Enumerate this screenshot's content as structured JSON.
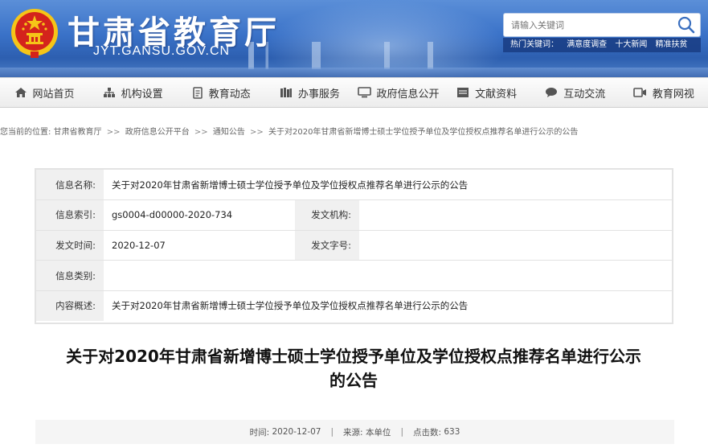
{
  "header": {
    "site_title": "甘肃省教育厅",
    "site_domain": "JYT.GANSU.GOV.CN",
    "search": {
      "placeholder": "请输入关键词"
    },
    "hotwords": {
      "label": "热门关键词：",
      "items": [
        "满意度调查",
        "十大新闻",
        "精准扶贫"
      ]
    }
  },
  "nav": {
    "items": [
      {
        "label": "网站首页",
        "icon": "home-icon"
      },
      {
        "label": "机构设置",
        "icon": "org-chart-icon"
      },
      {
        "label": "教育动态",
        "icon": "document-icon"
      },
      {
        "label": "办事服务",
        "icon": "books-icon"
      },
      {
        "label": "政府信息公开",
        "icon": "monitor-icon"
      },
      {
        "label": "文献资料",
        "icon": "folder-icon"
      },
      {
        "label": "互动交流",
        "icon": "chat-icon"
      },
      {
        "label": "教育网视",
        "icon": "video-icon"
      }
    ]
  },
  "breadcrumb": {
    "prefix": "您当前的位置:",
    "items": [
      "甘肃省教育厅",
      "政府信息公开平台",
      "通知公告",
      "关于对2020年甘肃省新增博士硕士学位授予单位及学位授权点推荐名单进行公示的公告"
    ],
    "separator": ">>"
  },
  "info": {
    "name_label": "信息名称:",
    "name_value": "关于对2020年甘肃省新增博士硕士学位授予单位及学位授权点推荐名单进行公示的公告",
    "index_label": "信息索引:",
    "index_value": "gs0004-d00000-2020-734",
    "org_label": "发文机构:",
    "org_value": "",
    "date_label": "发文时间:",
    "date_value": "2020-12-07",
    "docno_label": "发文字号:",
    "docno_value": "",
    "category_label": "信息类别:",
    "category_value": "",
    "summary_label": "内容概述:",
    "summary_value": "关于对2020年甘肃省新增博士硕士学位授予单位及学位授权点推荐名单进行公示的公告"
  },
  "article": {
    "title_line1": "关于对2020年甘肃省新增博士硕士学位授予单位及学位授权点推荐名单进行公示",
    "title_line2": "的公告"
  },
  "meta": {
    "time_label": "时间:",
    "time_value": "2020-12-07",
    "source_label": "来源:",
    "source_value": "本单位",
    "clicks_label": "点击数:",
    "clicks_value": "633"
  },
  "colors": {
    "header_blue": "#3a72c8",
    "emblem_red": "#d4231c",
    "emblem_gold": "#f5c518"
  }
}
